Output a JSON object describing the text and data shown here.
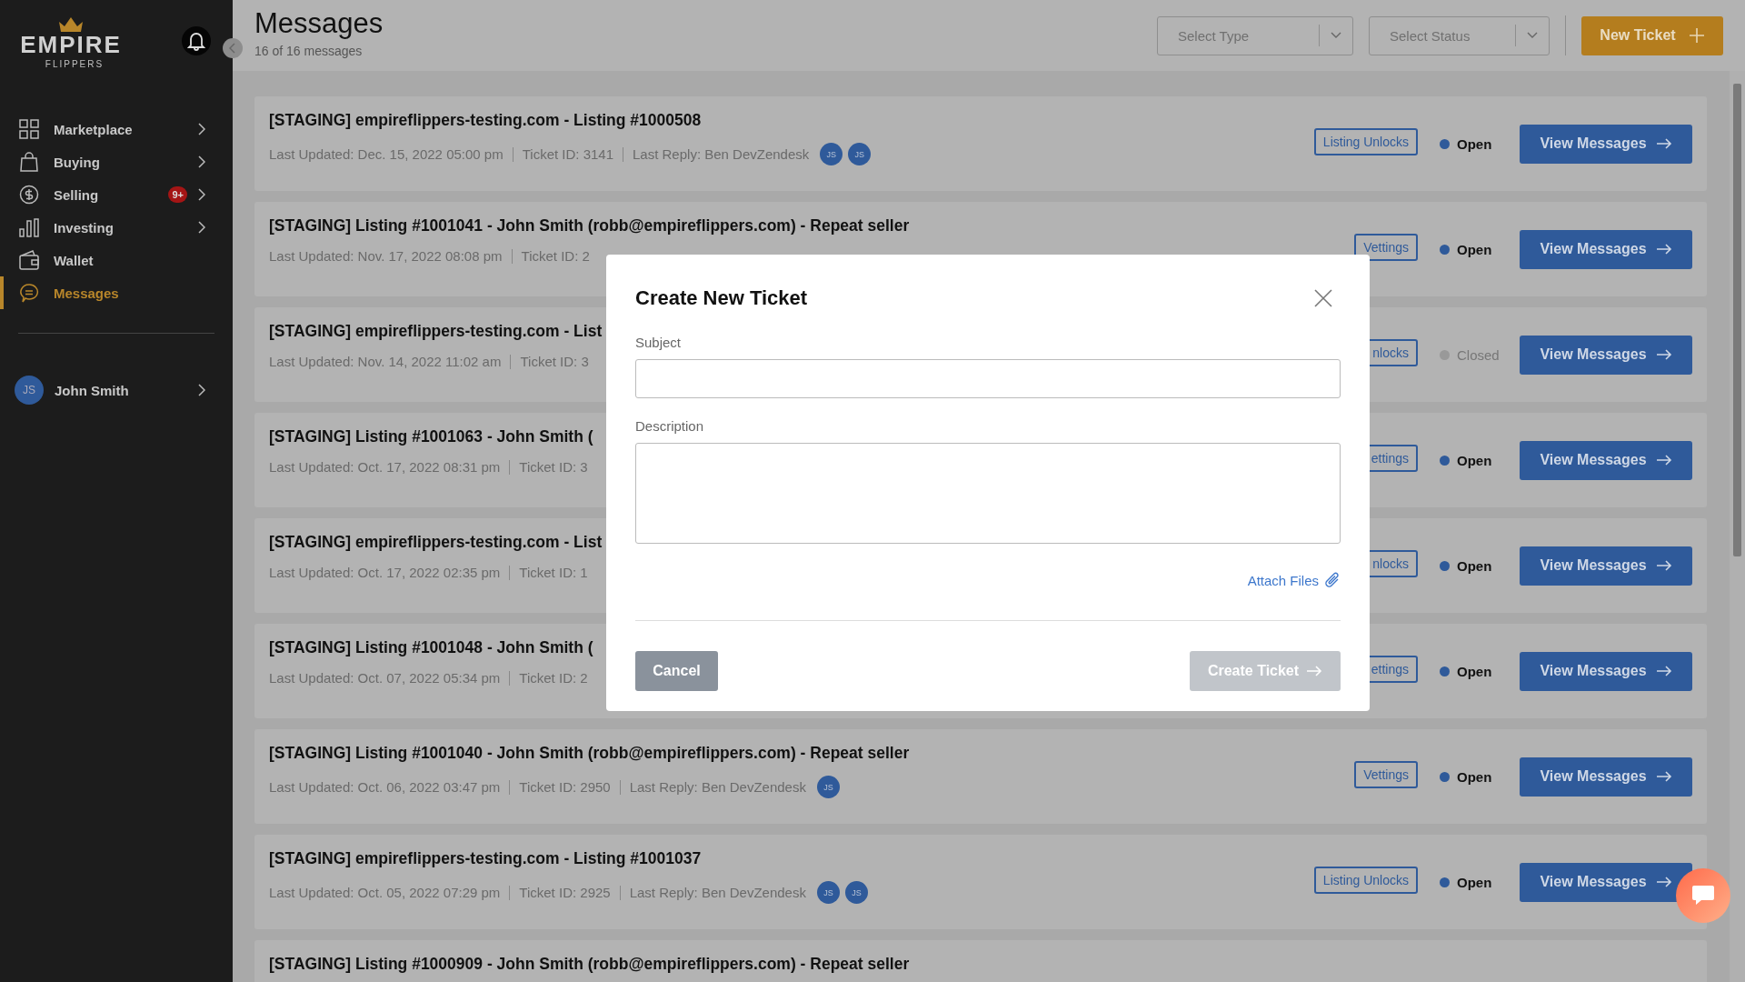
{
  "sidebar": {
    "logo": {
      "word": "EMPIRE",
      "sub": "FLIPPERS"
    },
    "nav": [
      {
        "label": "Marketplace",
        "kind": "grid",
        "selected": false,
        "expandable": true
      },
      {
        "label": "Buying",
        "kind": "bag",
        "selected": false,
        "expandable": true
      },
      {
        "label": "Selling",
        "kind": "dollar",
        "selected": false,
        "expandable": true,
        "badge": "9+"
      },
      {
        "label": "Investing",
        "kind": "bars",
        "selected": false,
        "expandable": true
      },
      {
        "label": "Wallet",
        "kind": "wallet",
        "selected": false,
        "expandable": false
      },
      {
        "label": "Messages",
        "kind": "chat",
        "selected": true,
        "expandable": false
      }
    ],
    "user": {
      "initials": "JS",
      "name": "John Smith"
    }
  },
  "header": {
    "title": "Messages",
    "count": "16 of 16 messages",
    "filters": [
      {
        "placeholder": "Select Type"
      },
      {
        "placeholder": "Select Status"
      }
    ],
    "new_ticket": "New Ticket"
  },
  "tickets": [
    {
      "title": "[STAGING] empireflippers-testing.com - Listing #1000508",
      "meta": [
        "Last Updated: Dec. 15, 2022 05:00 pm",
        "Ticket ID: 3141",
        "Last Reply: Ben DevZendesk"
      ],
      "avatars": [
        "JS",
        "JS"
      ],
      "tag": "Listing Unlocks",
      "status": "Open",
      "open": true,
      "action": "View Messages"
    },
    {
      "title": "[STAGING] Listing #1001041 - John Smith (robb@empireflippers.com) - Repeat seller",
      "meta": [
        "Last Updated: Nov. 17, 2022 08:08 pm",
        "Ticket ID: 2"
      ],
      "tag": "Vettings",
      "status": "Open",
      "open": true,
      "action": "View Messages"
    },
    {
      "title": "[STAGING] empireflippers-testing.com - List",
      "meta": [
        "Last Updated: Nov. 14, 2022 11:02 am",
        "Ticket ID: 3"
      ],
      "tag": "nlocks",
      "status": "Closed",
      "open": false,
      "action": "View Messages"
    },
    {
      "title": "[STAGING] Listing #1001063 - John Smith (",
      "meta": [
        "Last Updated: Oct. 17, 2022 08:31 pm",
        "Ticket ID: 3"
      ],
      "tag": "ettings",
      "status": "Open",
      "open": true,
      "action": "View Messages"
    },
    {
      "title": "[STAGING] empireflippers-testing.com - List",
      "meta": [
        "Last Updated: Oct. 17, 2022 02:35 pm",
        "Ticket ID: 1"
      ],
      "tag": "nlocks",
      "status": "Open",
      "open": true,
      "action": "View Messages"
    },
    {
      "title": "[STAGING] Listing #1001048 - John Smith (",
      "meta": [
        "Last Updated: Oct. 07, 2022 05:34 pm",
        "Ticket ID: 2"
      ],
      "tag": "ettings",
      "status": "Open",
      "open": true,
      "action": "View Messages"
    },
    {
      "title": "[STAGING] Listing #1001040 - John Smith (robb@empireflippers.com) - Repeat seller",
      "meta": [
        "Last Updated: Oct. 06, 2022 03:47 pm",
        "Ticket ID: 2950",
        "Last Reply: Ben DevZendesk"
      ],
      "avatars": [
        "JS"
      ],
      "tag": "Vettings",
      "status": "Open",
      "open": true,
      "action": "View Messages"
    },
    {
      "title": "[STAGING] empireflippers-testing.com - Listing #1001037",
      "meta": [
        "Last Updated: Oct. 05, 2022 07:29 pm",
        "Ticket ID: 2925",
        "Last Reply: Ben DevZendesk"
      ],
      "avatars": [
        "JS",
        "JS"
      ],
      "tag": "Listing Unlocks",
      "status": "Open",
      "open": true,
      "action": "View Messages"
    },
    {
      "title": "[STAGING] Listing #1000909 - John Smith (robb@empireflippers.com) - Repeat seller"
    }
  ],
  "modal": {
    "title": "Create New Ticket",
    "fields": [
      {
        "label": "Subject",
        "kind": "input"
      },
      {
        "label": "Description",
        "kind": "textarea"
      }
    ],
    "attach": "Attach Files",
    "cancel": "Cancel",
    "submit": {
      "label": "Create Ticket",
      "disabled": true
    }
  }
}
